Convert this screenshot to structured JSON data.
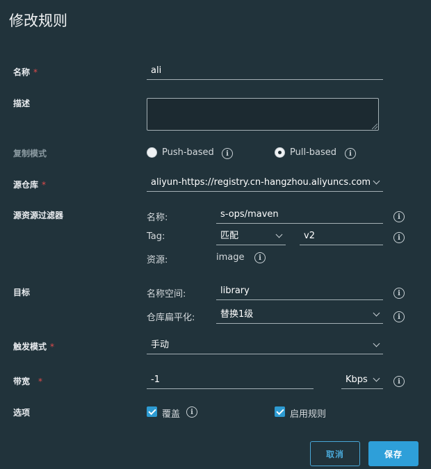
{
  "dialog": {
    "title": "修改规则"
  },
  "fields": {
    "name": {
      "label": "名称",
      "required_mark": "*",
      "value": "ali"
    },
    "description": {
      "label": "描述",
      "value": ""
    },
    "replication_mode": {
      "label": "复制模式",
      "options": [
        {
          "label": "Push-based",
          "selected": false
        },
        {
          "label": "Pull-based",
          "selected": true
        }
      ]
    },
    "source_registry": {
      "label": "源仓库",
      "required_mark": "*",
      "value": "aliyun-https://registry.cn-hangzhou.aliyuncs.com"
    },
    "source_filter": {
      "label": "源资源过滤器",
      "name_label": "名称:",
      "name_value": "s-ops/maven",
      "tag_label": "Tag:",
      "tag_match_value": "匹配",
      "tag_value": "v2",
      "resource_label": "资源:",
      "resource_value": "image"
    },
    "destination": {
      "label": "目标",
      "namespace_label": "名称空间:",
      "namespace_value": "library",
      "flatten_label": "仓库扁平化:",
      "flatten_value": "替换1级"
    },
    "trigger_mode": {
      "label": "触发模式",
      "required_mark": "*",
      "value": "手动"
    },
    "bandwidth": {
      "label": "带宽",
      "required_mark": "*",
      "value": "-1",
      "unit": "Kbps"
    },
    "options": {
      "label": "选项",
      "override": {
        "label": "覆盖",
        "checked": true
      },
      "enable_rule": {
        "label": "启用规则",
        "checked": true
      }
    }
  },
  "buttons": {
    "cancel": "取消",
    "save": "保存"
  },
  "icons": {
    "info": "i"
  },
  "colors": {
    "background": "#21333b",
    "accent": "#2e9fd9",
    "required": "#e14b4b"
  }
}
